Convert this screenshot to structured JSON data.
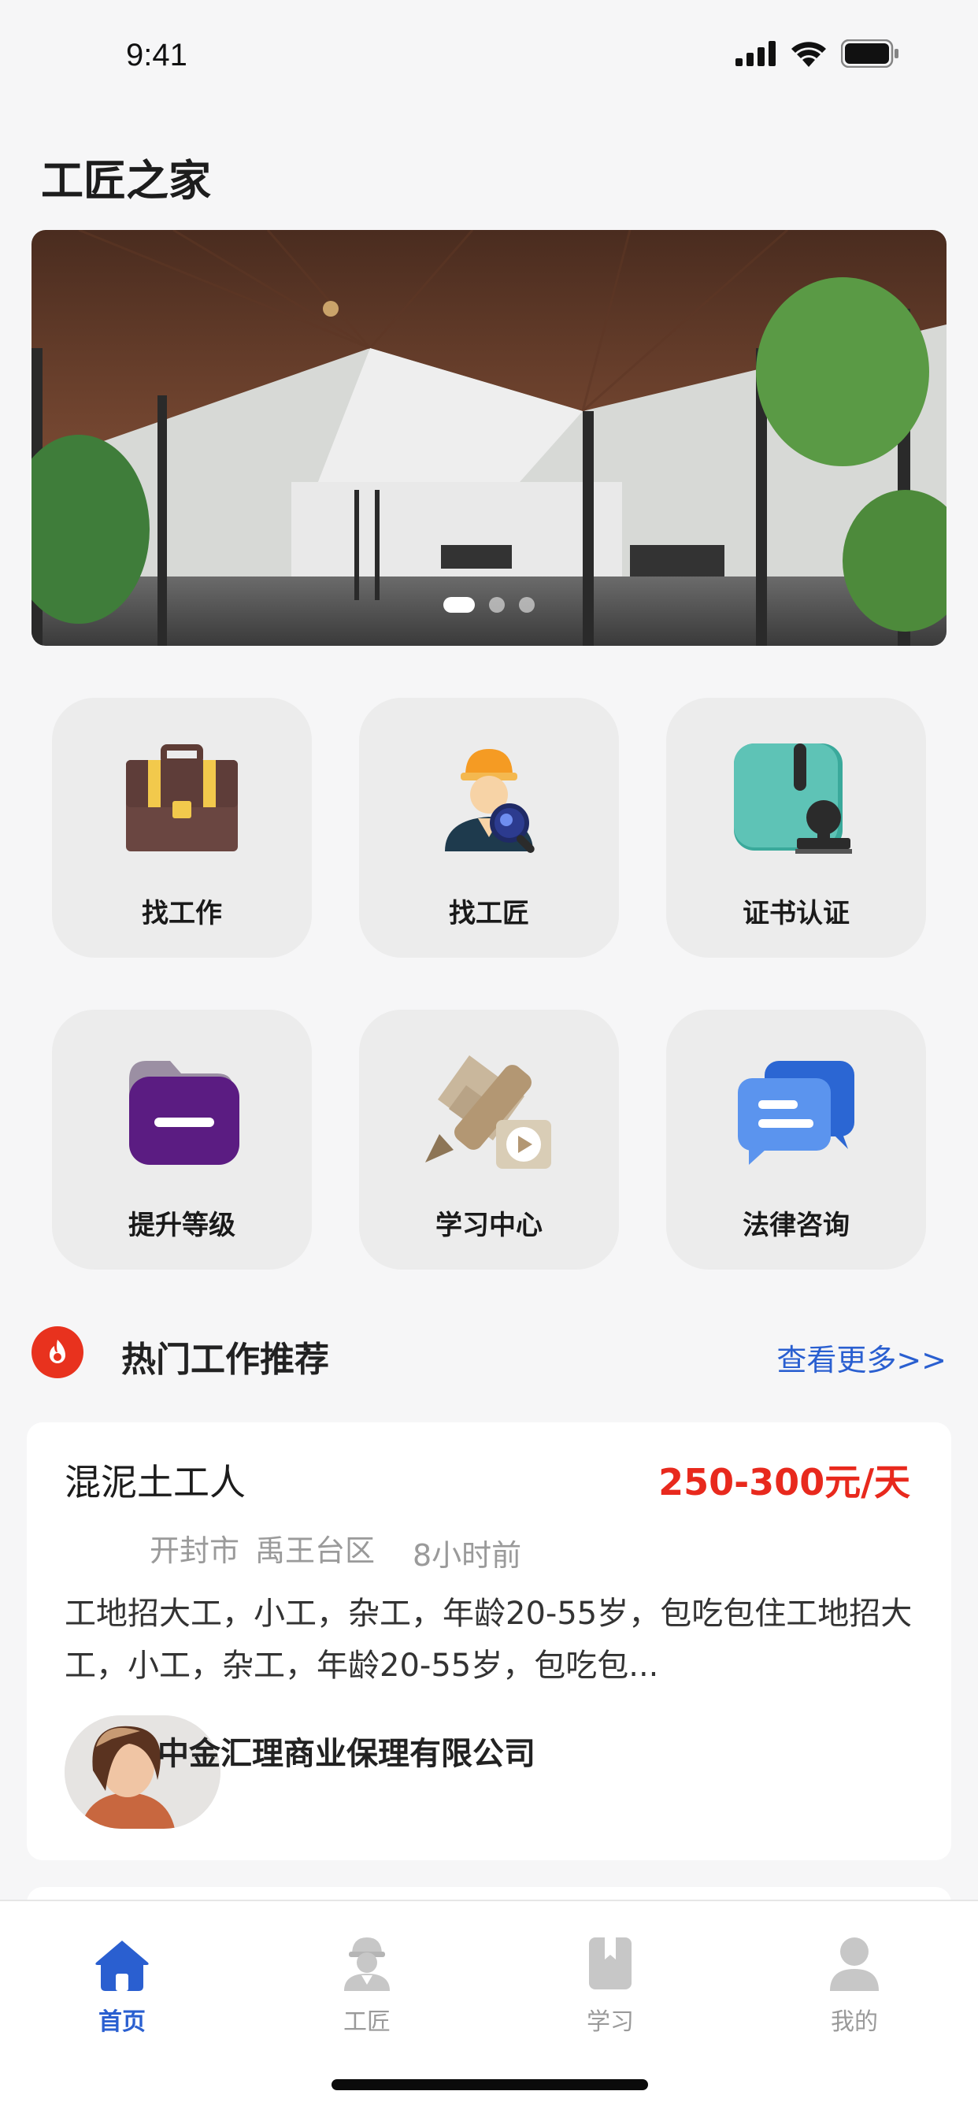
{
  "status_bar": {
    "time": "9:41"
  },
  "app_title": "工匠之家",
  "banner": {
    "dots": 3,
    "active_dot": 0
  },
  "features": [
    {
      "label": "找工作",
      "icon": "briefcase-icon"
    },
    {
      "label": "找工匠",
      "icon": "worker-search-icon"
    },
    {
      "label": "证书认证",
      "icon": "certificate-stamp-icon"
    },
    {
      "label": "提升等级",
      "icon": "folder-icon"
    },
    {
      "label": "学习中心",
      "icon": "pencil-video-icon"
    },
    {
      "label": "法律咨询",
      "icon": "chat-bubbles-icon"
    }
  ],
  "section": {
    "title": "热门工作推荐",
    "more": "查看更多>>"
  },
  "job": {
    "title": "混泥土工人",
    "salary": "250-300元/天",
    "city": "开封市",
    "district": "禹王台区",
    "posted": "8小时前",
    "description": "工地招大工，小工，杂工，年龄20-55岁，包吃包住工地招大工，小工，杂工，年龄20-55岁，包吃包...",
    "company": "中金汇理商业保理有限公司"
  },
  "tabs": [
    {
      "label": "首页",
      "icon": "home-icon",
      "active": true
    },
    {
      "label": "工匠",
      "icon": "worker-icon",
      "active": false
    },
    {
      "label": "学习",
      "icon": "book-icon",
      "active": false
    },
    {
      "label": "我的",
      "icon": "profile-icon",
      "active": false
    }
  ],
  "colors": {
    "accent": "#2a5fd0",
    "salary": "#e8291d",
    "fire": "#e8321e"
  }
}
